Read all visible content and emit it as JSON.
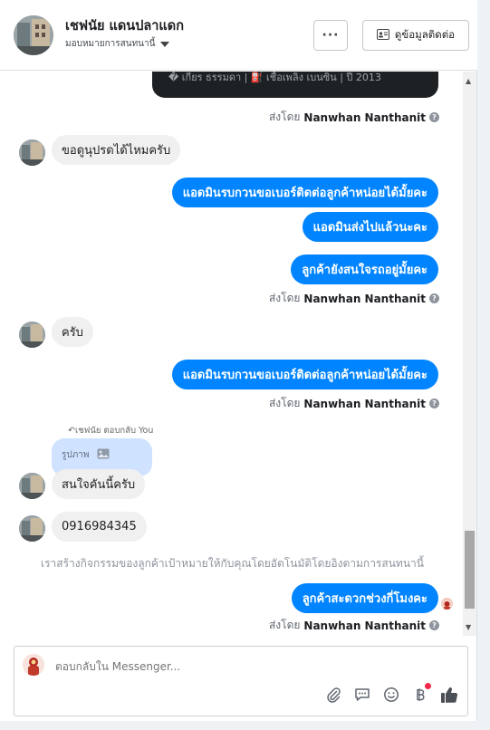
{
  "header": {
    "name": "เชฟนัย แดนปลาแดก",
    "subtitle": "มอบหมายการสนทนานี้",
    "more_label": "···",
    "contact_label": "ดูข้อมูลติดต่อ"
  },
  "media_caption": "� เกียร ธรรมดา  |  ⛽ เชื้อเพลิง เบนซิน  |  ปี 2013",
  "messages": {
    "sent_by_prefix": "ส่งโดย",
    "agent_name": "Nanwhan Nanthanit",
    "in_1": "ขอดูนุปรดได้ไหมครับ",
    "out_1": "แอดมินรบกวนขอเบอร์ติดต่อลูกค้าหน่อยได้มั้ยคะ",
    "out_2": "แอดมินส่งไปแล้วนะคะ",
    "out_3": "ลูกค้ายังสนใจรถอยู่มั้ยคะ",
    "in_2": "ครับ",
    "out_4": "แอดมินรบกวนขอเบอร์ติดต่อลูกค้าหน่อยได้มั้ยคะ",
    "reply_meta": "เชฟนัย ตอบกลับ You",
    "reply_quote": "รูปภาพ",
    "in_3": "สนใจคันนี้ครับ",
    "in_4": "0916984345",
    "system_note": "เราสร้างกิจกรรมของลูกค้าเป้าหมายให้กับคุณโดยอัตโนมัติโดยอิงตามการสนทนานี้",
    "out_5": "ลูกค้าสะดวกช่วงกี่โมงคะ"
  },
  "composer": {
    "placeholder": "ตอบกลับใน Messenger..."
  },
  "icons": [
    "attachment-icon",
    "saved-reply-icon",
    "emoji-icon",
    "payment-icon",
    "like-icon"
  ],
  "colors": {
    "accent": "#0084ff",
    "incoming_bubble": "#f1f0f0",
    "reply_quote_bg": "#cfe2ff",
    "notification_dot": "#f02849"
  }
}
